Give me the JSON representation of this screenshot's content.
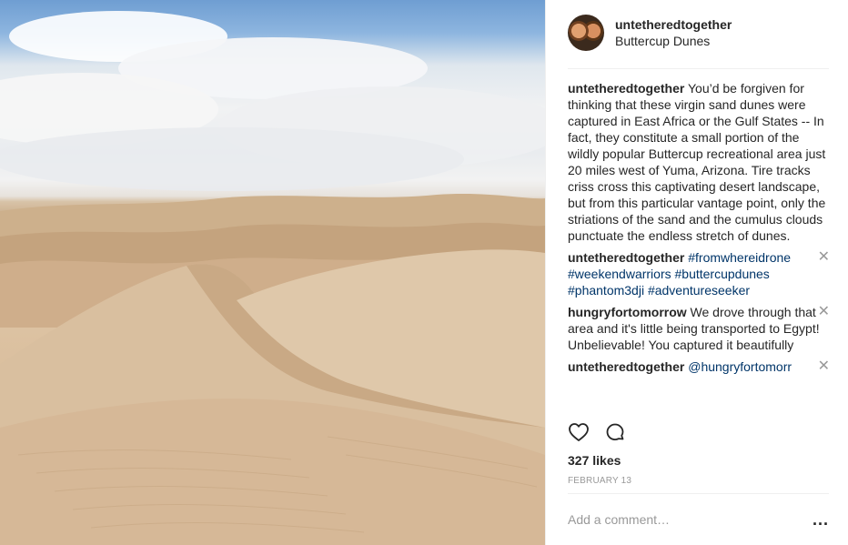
{
  "post": {
    "username": "untetheredtogether",
    "location": "Buttercup Dunes",
    "image_alt": "desert-dunes-photo"
  },
  "comments": [
    {
      "username": "untetheredtogether",
      "text": "You’d be forgiven for thinking that these virgin sand dunes were captured in East Africa or the Gulf States -- In fact, they constitute a small portion of the wildly popular Buttercup recreational area just 20 miles west of Yuma, Arizona. Tire tracks criss cross this captivating desert landscape, but from this particular vantage point, only the striations of the sand and the cumulus clouds punctuate the endless stretch of dunes."
    },
    {
      "username": "untetheredtogether",
      "text": "#fromwhereidrone #weekendwarriors #buttercupdunes #phantom3dji #adventureseeker"
    },
    {
      "username": "hungryfortomorrow",
      "text": "We drove through that area and it's little being transported to Egypt! Unbelievable! You captured it beautifully"
    },
    {
      "username": "untetheredtogether",
      "text": "@hungryfortomorr"
    }
  ],
  "likes": "327 likes",
  "date": "FEBRUARY 13",
  "comment_box": {
    "placeholder": "Add a comment…",
    "more": "..."
  },
  "icons": {
    "like": "heart-icon",
    "comment": "comment-icon",
    "close": "close-icon",
    "more": "more-options-icon"
  }
}
